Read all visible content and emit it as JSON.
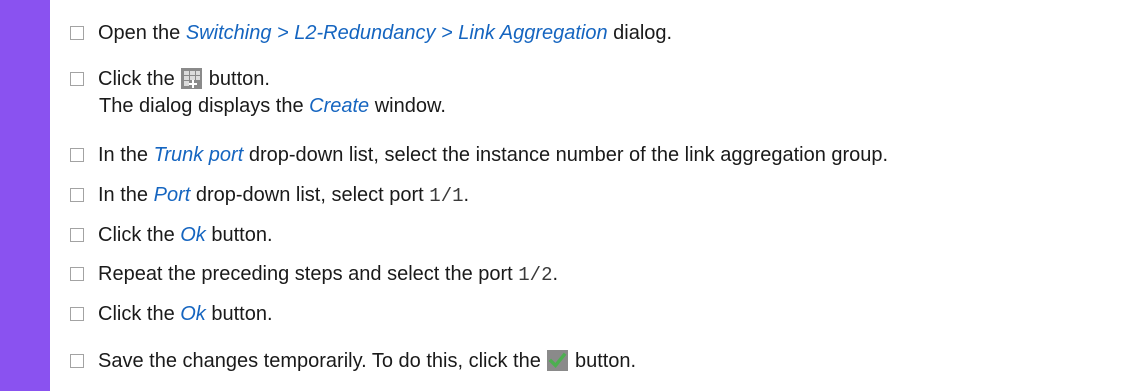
{
  "steps": [
    {
      "pre": "Open the ",
      "link": "Switching > L2-Redundancy > Link Aggregation",
      "post": " dialog."
    },
    {
      "pre": "Click the ",
      "icon": "create-table-icon",
      "post": " button.",
      "sub_pre": "The dialog displays the ",
      "sub_link": "Create",
      "sub_post": " window."
    },
    {
      "pre": "In the ",
      "link": "Trunk port",
      "post": " drop-down list, select the instance number of the link aggregation group."
    },
    {
      "pre": "In the ",
      "link": "Port",
      "mid": " drop-down list, select port ",
      "code": "1/1",
      "post": "."
    },
    {
      "pre": "Click the ",
      "link": "Ok",
      "post": " button."
    },
    {
      "pre": "Repeat the preceding steps and select the port ",
      "code": "1/2",
      "post": "."
    },
    {
      "pre": "Click the ",
      "link": "Ok",
      "post": " button."
    },
    {
      "pre": "Save the changes temporarily. To do this, click the ",
      "icon": "checkmark-icon",
      "post": " button."
    }
  ],
  "colors": {
    "accent_bar": "#8a52f0",
    "link": "#1565c0",
    "check_green": "#4caf50"
  }
}
